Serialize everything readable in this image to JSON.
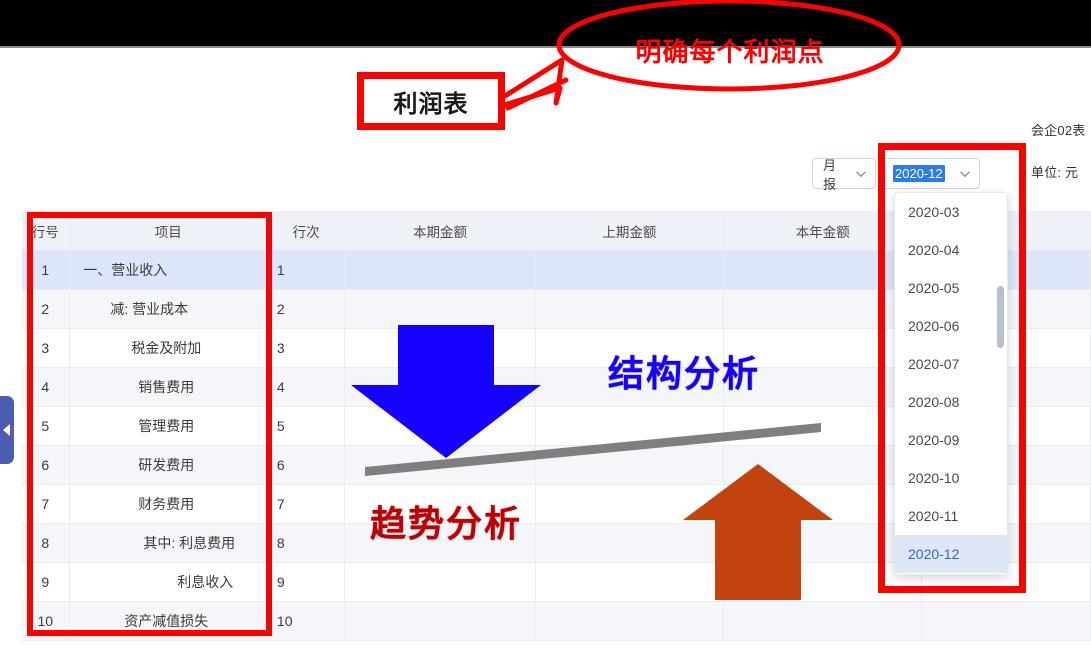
{
  "window": {
    "doc_title": "利润表"
  },
  "annotations": {
    "title_box_label": "利润表",
    "callout_label": "明确每个利润点",
    "structure_label": "结构分析",
    "trend_label": "趋势分析",
    "highlight_color": "#ff0000",
    "structure_color": "#1500ff",
    "trend_color": "#c00000",
    "down_arrow_color": "#1500ff",
    "up_arrow_color": "#c1440e",
    "trend_line_color": "#7f7f7f"
  },
  "meta": {
    "form_code": "会企02表",
    "unit": "单位: 元"
  },
  "toolbar": {
    "frequency": {
      "value": "月报",
      "icon": "chevron-down-icon"
    },
    "period": {
      "value": "2020-12",
      "icon": "chevron-down-icon",
      "selected_highlight": "#2b7de9"
    }
  },
  "period_dropdown": {
    "open": true,
    "selected": "2020-12",
    "options": [
      "2020-03",
      "2020-04",
      "2020-05",
      "2020-06",
      "2020-07",
      "2020-08",
      "2020-09",
      "2020-10",
      "2020-11",
      "2020-12"
    ]
  },
  "sidebar_handle": {
    "icon": "chevron-left-icon",
    "color": "#4a5db0"
  },
  "table": {
    "headers": [
      "行号",
      "项目",
      "行次",
      "本期金额",
      "上期金额",
      "本年金额",
      ""
    ],
    "selected_row_index": 0,
    "rows": [
      {
        "no": "1",
        "item": "一、营业收入",
        "indent": 0,
        "ord": "1",
        "current": "",
        "previous": "",
        "ytd": "",
        "extra": ""
      },
      {
        "no": "2",
        "item": "减: 营业成本",
        "indent": 1,
        "ord": "2",
        "current": "",
        "previous": "",
        "ytd": "",
        "extra": ""
      },
      {
        "no": "3",
        "item": "税金及附加",
        "indent": 2,
        "ord": "3",
        "current": "",
        "previous": "",
        "ytd": "",
        "extra": ""
      },
      {
        "no": "4",
        "item": "销售费用",
        "indent": 2,
        "ord": "4",
        "current": "",
        "previous": "",
        "ytd": "",
        "extra": ""
      },
      {
        "no": "5",
        "item": "管理费用",
        "indent": 2,
        "ord": "5",
        "current": "",
        "previous": "",
        "ytd": "",
        "extra": ""
      },
      {
        "no": "6",
        "item": "研发费用",
        "indent": 2,
        "ord": "6",
        "current": "",
        "previous": "",
        "ytd": "",
        "extra": ""
      },
      {
        "no": "7",
        "item": "财务费用",
        "indent": 2,
        "ord": "7",
        "current": "",
        "previous": "",
        "ytd": "",
        "extra": ""
      },
      {
        "no": "8",
        "item": "其中: 利息费用",
        "indent": 3,
        "ord": "8",
        "current": "",
        "previous": "",
        "ytd": "",
        "extra": ""
      },
      {
        "no": "9",
        "item": "利息收入",
        "indent": 4,
        "ord": "9",
        "current": "",
        "previous": "",
        "ytd": "",
        "extra": ""
      },
      {
        "no": "10",
        "item": "资产减值损失",
        "indent": 2,
        "ord": "10",
        "current": "",
        "previous": "",
        "ytd": "",
        "extra": ""
      }
    ]
  }
}
